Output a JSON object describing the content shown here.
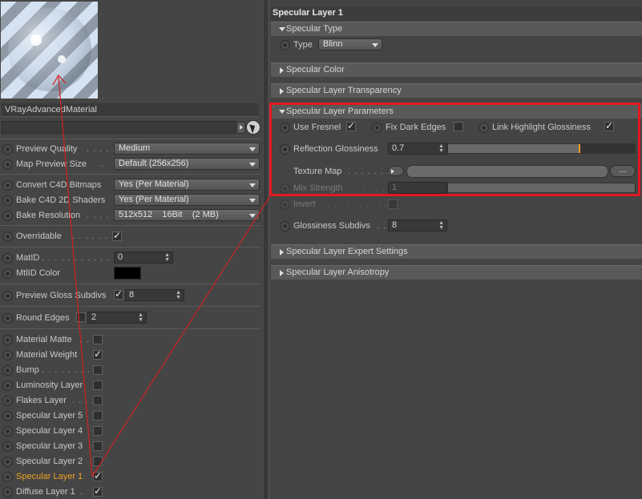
{
  "material": {
    "name": "VRayAdvancedMaterial",
    "search_value": "",
    "preview_quality": {
      "label": "Preview Quality",
      "value": "Medium"
    },
    "map_preview_size": {
      "label": "Map Preview Size",
      "value": "Default (256x256)"
    },
    "convert_bitmaps": {
      "label": "Convert C4D Bitmaps",
      "value": "Yes (Per Material)"
    },
    "bake_shaders": {
      "label": "Bake C4D 2D Shaders",
      "value": "Yes (Per Material)"
    },
    "bake_resolution": {
      "label": "Bake Resolution",
      "value": "512x512    16Bit    (2 MB)"
    },
    "overridable": {
      "label": "Overridable",
      "checked": true
    },
    "matid": {
      "label": "MatID",
      "value": "0"
    },
    "mtlid_color": {
      "label": "MtlID Color",
      "color": "#000000"
    },
    "preview_gloss_subdivs": {
      "label": "Preview Gloss Subdivs",
      "checked": true,
      "value": "8"
    },
    "round_edges": {
      "label": "Round Edges",
      "checked": false,
      "value": "2"
    },
    "layers": [
      {
        "label": "Material Matte",
        "checked": false
      },
      {
        "label": "Material Weight",
        "checked": true
      },
      {
        "label": "Bump",
        "checked": false
      },
      {
        "label": "Luminosity Layer",
        "checked": false
      },
      {
        "label": "Flakes Layer",
        "checked": false
      },
      {
        "label": "Specular Layer 5",
        "checked": false
      },
      {
        "label": "Specular Layer 4",
        "checked": false
      },
      {
        "label": "Specular Layer 3",
        "checked": false
      },
      {
        "label": "Specular Layer 2",
        "checked": false
      },
      {
        "label": "Specular Layer 1",
        "checked": true,
        "active": true
      },
      {
        "label": "Diffuse Layer 1",
        "checked": true
      }
    ]
  },
  "panel": {
    "title": "Specular Layer 1",
    "specular_type": {
      "section": "Specular Type",
      "type_label": "Type",
      "type_value": "Blinn"
    },
    "specular_color": {
      "section": "Specular Color"
    },
    "transparency": {
      "section": "Specular Layer Transparency"
    },
    "parameters": {
      "section": "Specular Layer Parameters",
      "use_fresnel": {
        "label": "Use Fresnel",
        "checked": true
      },
      "fix_dark_edges": {
        "label": "Fix Dark Edges",
        "checked": false
      },
      "link_highlight": {
        "label": "Link Highlight Glossiness",
        "checked": true
      },
      "reflection_glossiness": {
        "label": "Reflection Glossiness",
        "value": "0.7",
        "fraction": 0.7
      },
      "texture_map": {
        "label": "Texture Map",
        "button": "..."
      },
      "mix_strength": {
        "label": "Mix Strength",
        "value": "1"
      },
      "invert": {
        "label": "Invert",
        "checked": false
      },
      "glossiness_subdivs": {
        "label": "Glossiness Subdivs",
        "value": "8"
      }
    },
    "expert": {
      "section": "Specular Layer Expert Settings"
    },
    "anisotropy": {
      "section": "Specular Layer Anisotropy"
    }
  },
  "colors": {
    "accent": "#f0a020",
    "highlight_box": "#e0191f",
    "arrow": "#d02020"
  }
}
